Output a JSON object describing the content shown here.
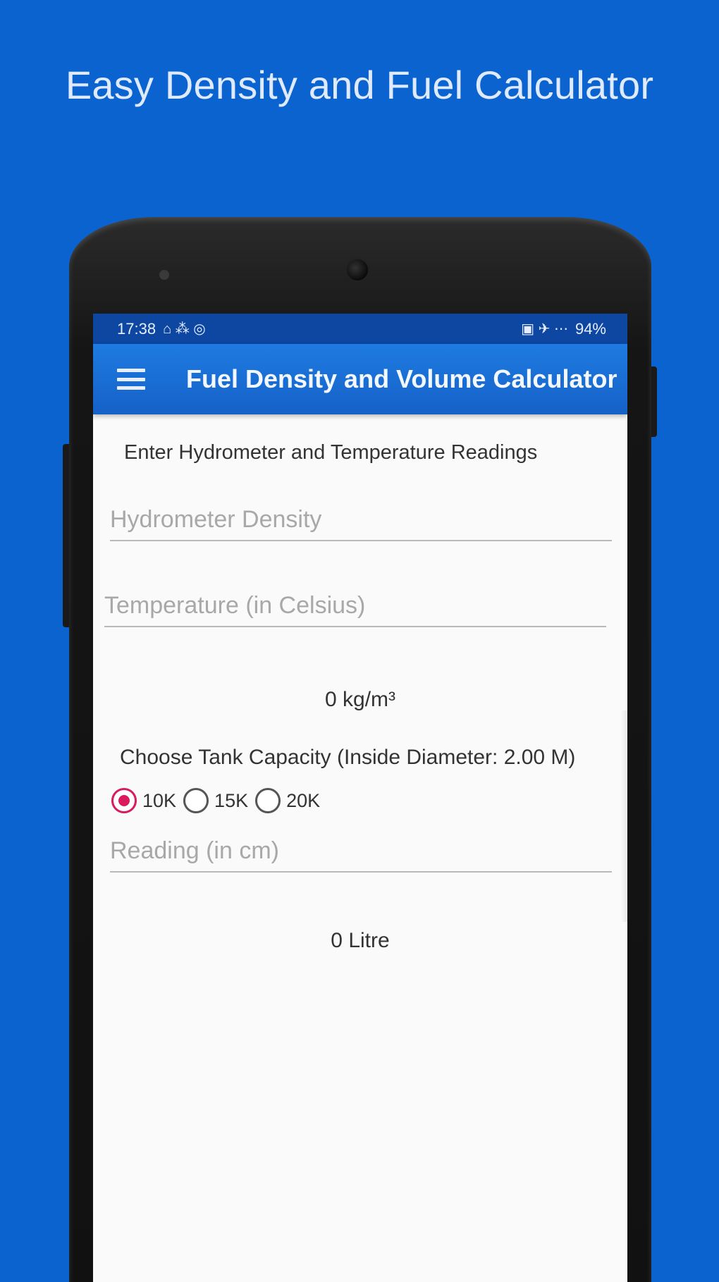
{
  "promo": {
    "title": "Easy Density and Fuel Calculator"
  },
  "statusbar": {
    "time": "17:38",
    "left_icons": "⌂ ⁂ ◎",
    "right_icons": "▣ ✈ ⋯",
    "battery": "94%"
  },
  "appbar": {
    "title": "Fuel Density and Volume Calculator"
  },
  "form": {
    "instruction": "Enter Hydrometer and Temperature Readings",
    "density_placeholder": "Hydrometer Density",
    "temperature_placeholder": "Temperature (in Celsius)",
    "density_result": "0 kg/m³",
    "tank_label": "Choose Tank Capacity (Inside Diameter: 2.00 M)",
    "tank_options": [
      "10K",
      "15K",
      "20K"
    ],
    "selected_tank": "10K",
    "reading_placeholder": "Reading (in cm)",
    "volume_result": "0 Litre"
  },
  "colors": {
    "background": "#0a63cf",
    "appbar": "#1561c8",
    "statusbar": "#0d47a1",
    "accent": "#d81b60"
  }
}
